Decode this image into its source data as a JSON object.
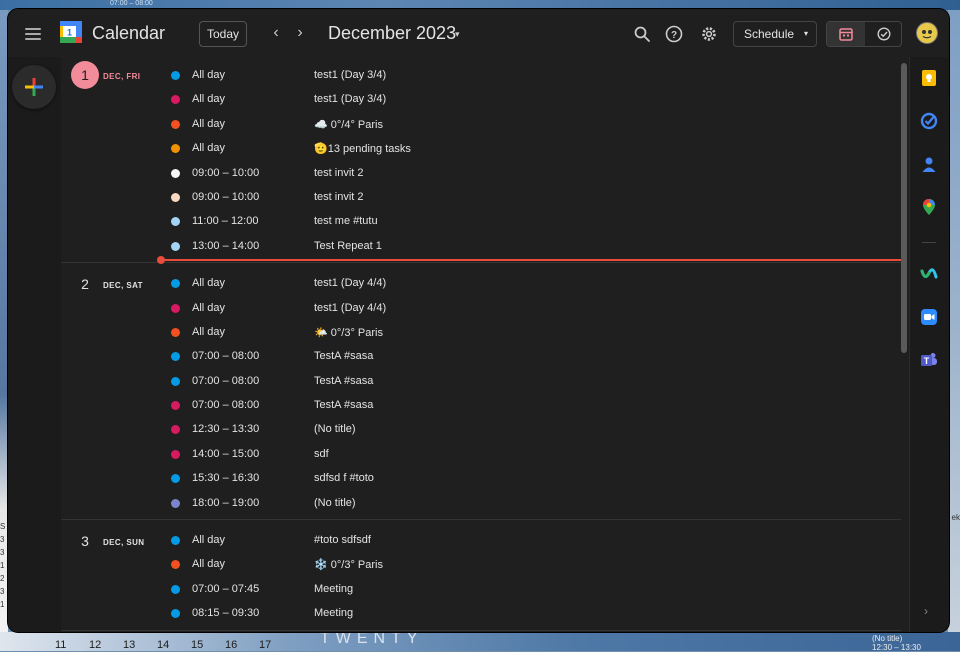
{
  "desktop": {
    "top_text": "07:00 – 08:00",
    "left_nums": [
      "S",
      "3",
      "3",
      "1",
      "2",
      "3",
      "1"
    ],
    "right_text": "ek",
    "bottom_nums": [
      "11",
      "12",
      "13",
      "14",
      "15",
      "16",
      "17"
    ],
    "bottom_word": "TWENTY",
    "bottom_right_line1": "(No title)",
    "bottom_right_line2": "12:30 – 13:30"
  },
  "header": {
    "app_title": "Calendar",
    "logo_day": "1",
    "today_label": "Today",
    "prev_label": "‹",
    "next_label": "›",
    "month_title": "December 2023",
    "month_caret": "▾",
    "view_label": "Schedule",
    "view_caret": "▾",
    "icons": [
      "search-icon",
      "help-icon",
      "settings-icon",
      "calendar-icon",
      "tasks-icon",
      "avatar"
    ]
  },
  "colors": {
    "today_badge": "#f28b9a",
    "now_line": "#e74c3c",
    "blue": "#039be5",
    "crimson": "#d81b60",
    "tomato": "#f4511e",
    "tangerine": "#f09300",
    "white": "#f6f6f6",
    "peach": "#f8d9c4",
    "light_blue": "#a4d4f5",
    "lavender": "#7986cb"
  },
  "days": [
    {
      "num": "1",
      "label": "DEC, FRI",
      "today": true,
      "events": [
        {
          "time": "All day",
          "title": "test1 (Day 3/4)",
          "color": "#039be5"
        },
        {
          "time": "All day",
          "title": "test1 (Day 3/4)",
          "color": "#d81b60"
        },
        {
          "time": "All day",
          "title": "☁️ 0°/4° Paris",
          "color": "#f4511e"
        },
        {
          "time": "All day",
          "title": "🫡13 pending tasks",
          "color": "#f09300"
        },
        {
          "time": "09:00 – 10:00",
          "title": "test invit 2",
          "color": "#f6f6f6"
        },
        {
          "time": "09:00 – 10:00",
          "title": "test invit 2",
          "color": "#f8d9c4"
        },
        {
          "time": "11:00 – 12:00",
          "title": "test me #tutu",
          "color": "#a4d4f5"
        },
        {
          "time": "13:00 – 14:00",
          "title": "Test Repeat 1",
          "color": "#a4d4f5"
        }
      ]
    },
    {
      "num": "2",
      "label": "DEC, SAT",
      "today": false,
      "events": [
        {
          "time": "All day",
          "title": "test1 (Day 4/4)",
          "color": "#039be5"
        },
        {
          "time": "All day",
          "title": "test1 (Day 4/4)",
          "color": "#d81b60"
        },
        {
          "time": "All day",
          "title": "🌤️ 0°/3° Paris",
          "color": "#f4511e"
        },
        {
          "time": "07:00 – 08:00",
          "title": "TestA #sasa",
          "color": "#039be5"
        },
        {
          "time": "07:00 – 08:00",
          "title": "TestA #sasa",
          "color": "#039be5"
        },
        {
          "time": "07:00 – 08:00",
          "title": "TestA #sasa",
          "color": "#d81b60"
        },
        {
          "time": "12:30 – 13:30",
          "title": "(No title)",
          "color": "#d81b60"
        },
        {
          "time": "14:00 – 15:00",
          "title": "sdf",
          "color": "#d81b60"
        },
        {
          "time": "15:30 – 16:30",
          "title": "sdfsd f #toto",
          "color": "#039be5"
        },
        {
          "time": "18:00 – 19:00",
          "title": "(No title)",
          "color": "#7986cb"
        }
      ]
    },
    {
      "num": "3",
      "label": "DEC, SUN",
      "today": false,
      "events": [
        {
          "time": "All day",
          "title": "#toto sdfsdf",
          "color": "#039be5"
        },
        {
          "time": "All day",
          "title": "❄️ 0°/3° Paris",
          "color": "#f4511e"
        },
        {
          "time": "07:00 – 07:45",
          "title": "Meeting",
          "color": "#039be5"
        },
        {
          "time": "08:15 – 09:30",
          "title": "Meeting",
          "color": "#039be5"
        }
      ]
    }
  ],
  "right_rail": {
    "icons": [
      "keep-icon",
      "tasks-icon",
      "contacts-icon",
      "maps-icon",
      "webex-icon",
      "zoom-icon",
      "teams-icon"
    ],
    "expand_label": "›"
  }
}
